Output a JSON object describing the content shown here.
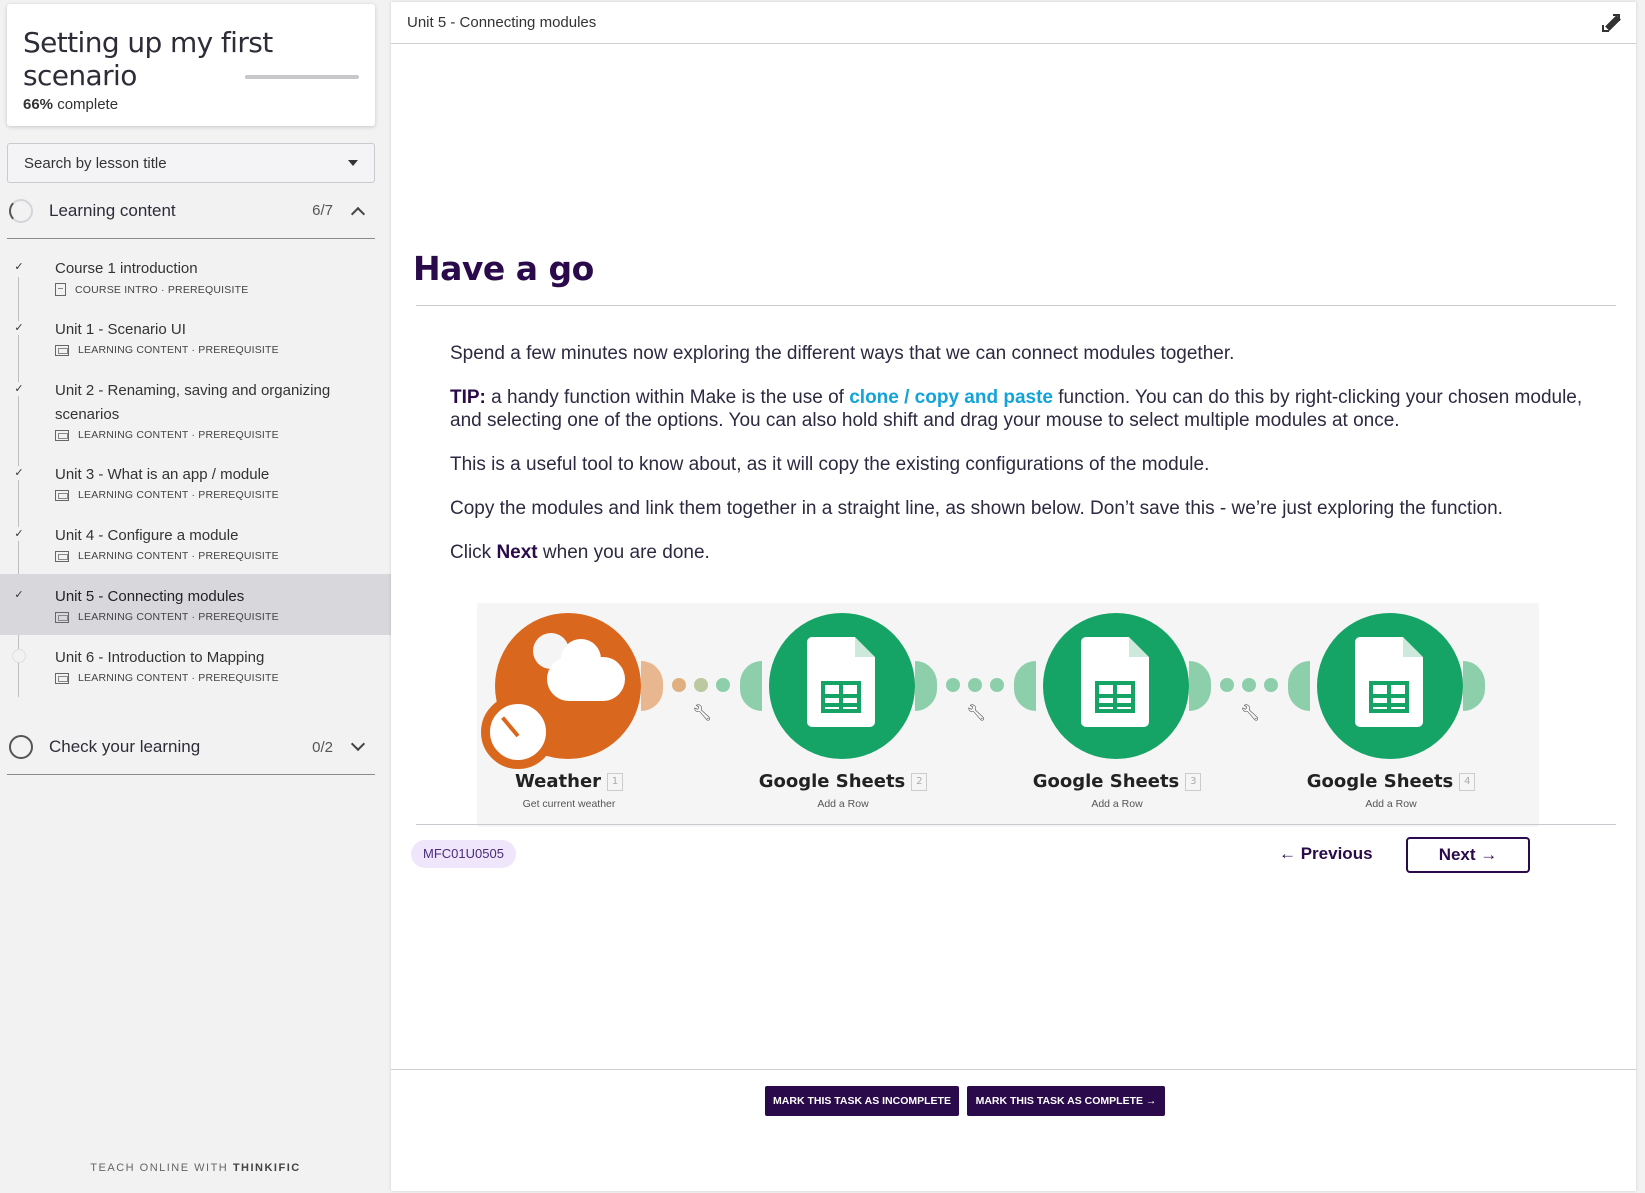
{
  "sidebar": {
    "course_title": "Setting up my first scenario",
    "progress_percent": 66,
    "progress_value": "66%",
    "progress_suffix": "complete",
    "search_placeholder": "Search by lesson title",
    "chapters": [
      {
        "title": "Learning content",
        "count": "6/7",
        "expanded": true
      },
      {
        "title": "Check your learning",
        "count": "0/2",
        "expanded": false
      }
    ],
    "lessons": [
      {
        "title": "Course 1 introduction",
        "meta": "COURSE INTRO · PREREQUISITE",
        "done": true
      },
      {
        "title": "Unit 1 - Scenario UI",
        "meta": "LEARNING CONTENT · PREREQUISITE",
        "done": true
      },
      {
        "title": "Unit 2 - Renaming, saving and organizing scenarios",
        "meta": "LEARNING CONTENT · PREREQUISITE",
        "done": true
      },
      {
        "title": "Unit 3 - What is an app / module",
        "meta": "LEARNING CONTENT · PREREQUISITE",
        "done": true
      },
      {
        "title": "Unit 4 - Configure a module",
        "meta": "LEARNING CONTENT · PREREQUISITE",
        "done": true
      },
      {
        "title": "Unit 5 - Connecting modules",
        "meta": "LEARNING CONTENT · PREREQUISITE",
        "done": true,
        "active": true
      },
      {
        "title": "Unit 6 - Introduction to Mapping",
        "meta": "LEARNING CONTENT · PREREQUISITE",
        "done": false
      }
    ],
    "footer_prefix": "TEACH ONLINE WITH",
    "footer_brand": "THINKIFIC"
  },
  "main": {
    "unit_title": "Unit 5 - Connecting modules",
    "heading": "Have a go",
    "para1": "Spend a few minutes now exploring the different ways that we can connect modules together.",
    "tip_label": "TIP:",
    "tip_pre": " a handy function within Make is the use of ",
    "tip_link": "clone / copy and paste",
    "tip_post": " function. You can do this by right-clicking your chosen module, and selecting one of the options. You can also hold shift and drag your mouse to select multiple modules at once.",
    "para3": "This is a useful tool to know about, as it will copy the existing configurations of the module.",
    "para4": "Copy the modules and link them together in a straight line, as shown below. Don’t save this - we’re just exploring the function.",
    "para5_pre": "Click ",
    "para5_bold": "Next",
    "para5_post": " when you are done.",
    "modules": [
      {
        "name": "Weather",
        "num": "1",
        "sub": "Get current weather",
        "icon": "weather-icon",
        "color": "#d9681e"
      },
      {
        "name": "Google Sheets",
        "num": "2",
        "sub": "Add a Row",
        "icon": "google-sheets-icon",
        "color": "#16a366"
      },
      {
        "name": "Google Sheets",
        "num": "3",
        "sub": "Add a Row",
        "icon": "google-sheets-icon",
        "color": "#16a366"
      },
      {
        "name": "Google Sheets",
        "num": "4",
        "sub": "Add a Row",
        "icon": "google-sheets-icon",
        "color": "#16a366"
      }
    ],
    "lesson_code": "MFC01U0505",
    "prev_label": "← Previous",
    "next_label": "Next →",
    "mark_incomplete": "MARK THIS TASK AS INCOMPLETE",
    "mark_complete": "MARK THIS TASK AS COMPLETE →"
  },
  "colors": {
    "brand_dark": "#2a0a4a",
    "link": "#12a3d9",
    "sheets_green": "#16a366",
    "weather_orange": "#d9681e",
    "tag_bg": "#f0e6fb"
  }
}
